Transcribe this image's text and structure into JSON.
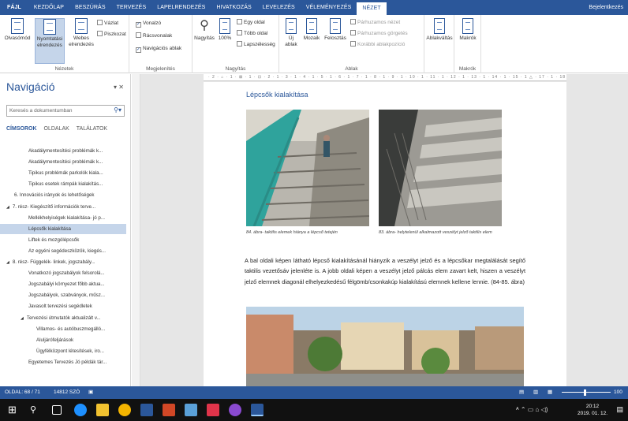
{
  "ribbon_tabs": [
    "FÁJL",
    "KEZDŐLAP",
    "BESZÚRÁS",
    "TERVEZÉS",
    "LAPELRENDEZÉS",
    "HIVATKOZÁS",
    "LEVELEZÉS",
    "VÉLEMÉNYEZÉS",
    "NÉZET"
  ],
  "signin": "Bejelentkezés",
  "groups": {
    "views": {
      "label": "Nézetek",
      "read": "Olvasómód",
      "print_line1": "Nyomtatási",
      "print_line2": "elrendezés",
      "web_line1": "Webes",
      "web_line2": "elrendezés",
      "outline": "Vázlat",
      "draft": "Piszkozat"
    },
    "show": {
      "label": "Megjelenítés",
      "ruler": "Vonalzó",
      "gridlines": "Rácsvonalak",
      "navpane": "Navigációs ablak"
    },
    "zoom": {
      "label": "Nagyítás",
      "zoom": "Nagyítás",
      "hundred": "100%",
      "one_page": "Egy oldal",
      "multi_page": "Több oldal",
      "page_width": "Lapszélesség"
    },
    "window": {
      "label": "Ablak",
      "new_line1": "Új",
      "new_line2": "ablak",
      "arrange": "Mozaik",
      "split": "Felosztás",
      "side_by_side": "Párhuzamos nézet",
      "sync_scroll": "Párhuzamos görgetés",
      "reset_pos": "Korábbi ablakpozíció",
      "switch": "Ablakváltás"
    },
    "macros": {
      "label": "Makrók",
      "macros": "Makrók"
    }
  },
  "nav": {
    "title": "Navigáció",
    "search_placeholder": "Keresés a dokumentumban",
    "tabs": [
      "CÍMSOROK",
      "OLDALAK",
      "TALÁLATOK"
    ],
    "items": [
      {
        "text": "Akadálymentesítési problémák k...",
        "level": 2
      },
      {
        "text": "Akadálymentesítési problémák k...",
        "level": 2
      },
      {
        "text": "Tipikus problémák parkolók kiala...",
        "level": 2
      },
      {
        "text": "Tipikus esetek rámpák kialakítás...",
        "level": 2
      },
      {
        "text": "6. Innovációs irányok és lehetőségek",
        "level": 1
      },
      {
        "text": "7. rész- Kiegészítő információk terve...",
        "level": 1,
        "toggle": "◢"
      },
      {
        "text": "Mellékhelyiségek kialakítása- jó p...",
        "level": 2
      },
      {
        "text": "Lépcsők kialakítása",
        "level": 2,
        "selected": true
      },
      {
        "text": "Liftek és mozgólépcsők",
        "level": 2
      },
      {
        "text": "Az egyéni segédeszközök, kiegés...",
        "level": 2
      },
      {
        "text": "8. rész- Függelék- linkek, jogszabály...",
        "level": 1,
        "toggle": "◢"
      },
      {
        "text": "Vonatkozó jogszabályok felsorolá...",
        "level": 2
      },
      {
        "text": "Jogszabályi környezet főbb aktua...",
        "level": 2
      },
      {
        "text": "Jogszabályok, szabványok, műsz...",
        "level": 2
      },
      {
        "text": "Javasolt tervezési segédletek",
        "level": 2
      },
      {
        "text": "Tervezési útmutatók aktualizált v...",
        "level": 2,
        "toggle": "◢"
      },
      {
        "text": "Villamos- és autóbuszmegálló...",
        "level": 3
      },
      {
        "text": "Aluljárófeljárások",
        "level": 3
      },
      {
        "text": "Ügyfélközpont létesítések, iro...",
        "level": 3
      },
      {
        "text": "Egyetemes Tervezés Jó példák tár...",
        "level": 2
      }
    ]
  },
  "document": {
    "ruler": "· 2 · ⌂ · 1 · ⊠ · 1 · ⊡ · 2 · 1 · 3 · 1 · 4 · 1 · 5 · 1 · 6 · 1 · 7 · 1 · 8 · 1 · 9 · 1 · 10 · 1 · 11 · 1 · 12 · 1 · 13 · 1 · 14 · 1 · 15 · 1 △ · 17 · 1 · 18",
    "heading": "Lépcsők kialakítása",
    "caption_left": "84. ábra- taktilis elemek hiánya a lépcső tetején",
    "caption_right": "83. ábra- helytelenül alkalmazott veszélyt jelző taktilis elem",
    "paragraph": "A bal oldali képen látható lépcső kialakításánál hiányzik a veszélyt jelző és a lépcsőkar megtalálását segítő taktilis vezetősáv jelenléte is. A jobb oldali képen a veszélyt jelző pálcás elem zavart kelt, hiszen a veszélyt jelző elemnek diagonál elhelyezkedésű félgömb/csonkakúp kialakítású elemnek kellene lennie. (84-85. ábra)"
  },
  "status": {
    "page": "OLDAL: 68 / 71",
    "words": "14812 SZÓ",
    "zoom": "100"
  },
  "clock": {
    "time": "20:12",
    "date": "2019. 01. 12."
  },
  "colors": {
    "accent": "#2b579a",
    "nav_selected": "#c5d5ea",
    "taskbar": "#111111"
  }
}
